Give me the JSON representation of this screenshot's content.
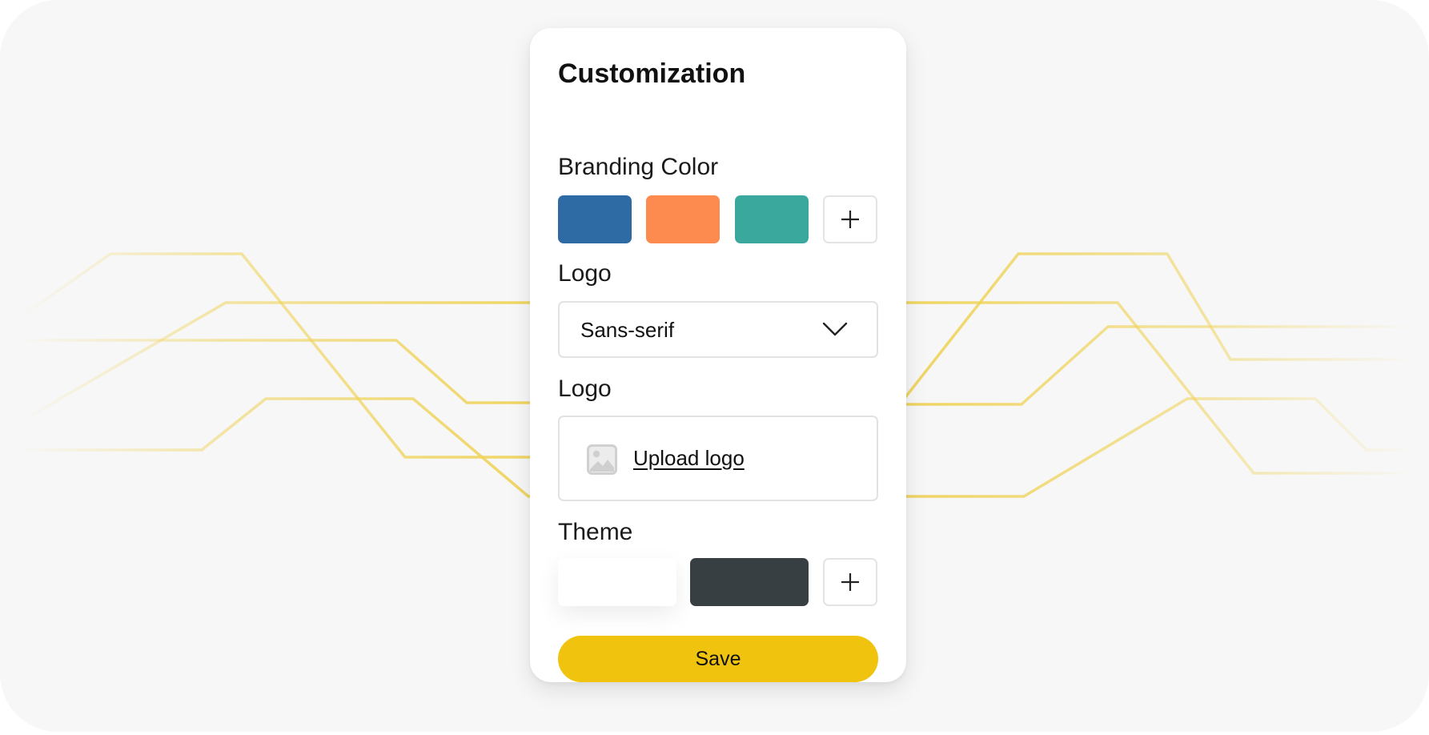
{
  "card": {
    "title": "Customization"
  },
  "branding": {
    "label": "Branding Color",
    "swatches": [
      {
        "name": "blue",
        "color": "#2e6aa3"
      },
      {
        "name": "orange",
        "color": "#fd8b4f"
      },
      {
        "name": "teal",
        "color": "#3aa89d"
      }
    ],
    "add_icon": "plus-icon"
  },
  "logo_font": {
    "label": "Logo",
    "selected": "Sans-serif",
    "icon": "chevron-down-icon"
  },
  "logo_upload": {
    "label": "Logo",
    "link_text": "Upload logo",
    "icon": "image-icon"
  },
  "theme": {
    "label": "Theme",
    "swatches": [
      {
        "name": "light",
        "color": "#ffffff"
      },
      {
        "name": "dark",
        "color": "#373f43"
      }
    ],
    "add_icon": "plus-icon"
  },
  "save": {
    "label": "Save",
    "color": "#f0c30f"
  },
  "colors": {
    "background": "#f7f7f7",
    "card": "#ffffff",
    "accent_lines": "#efd35a"
  }
}
